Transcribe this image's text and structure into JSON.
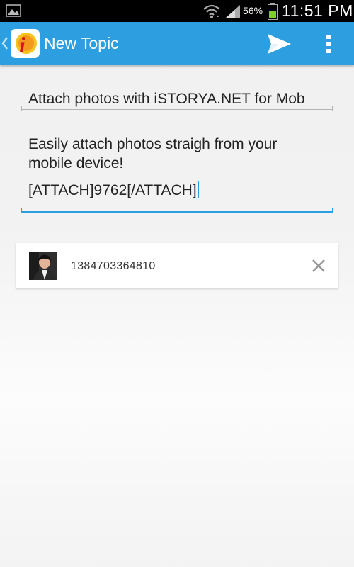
{
  "status_bar": {
    "battery_percent": "56%",
    "time": "11:51 PM",
    "icons": [
      "gallery-icon",
      "wifi-icon",
      "signal-icon",
      "battery-icon"
    ]
  },
  "action_bar": {
    "title": "New Topic",
    "color": "#2d9ee0",
    "icons": [
      "back-chevron-icon",
      "app-logo-icon",
      "send-icon",
      "overflow-menu-icon"
    ]
  },
  "form": {
    "subject_value": "Attach photos with iSTORYA.NET for Mob",
    "message_lines": [
      "Easily attach photos straigh from your",
      "mobile device!"
    ],
    "message_attach_tag": "[ATTACH]9762[/ATTACH]"
  },
  "attachments": [
    {
      "name": "1384703364810"
    }
  ]
}
